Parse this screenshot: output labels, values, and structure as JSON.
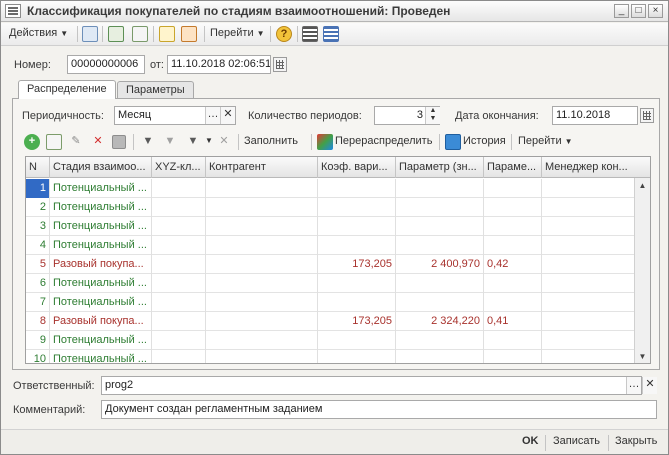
{
  "window": {
    "title": "Классификация покупателей по стадиям взаимоотношений: Проведен",
    "minimize": "_",
    "maximize": "□",
    "close": "×"
  },
  "toolbar": {
    "actions_label": "Действия",
    "goto_label": "Перейти",
    "icons": [
      "post-icon",
      "refresh-icon",
      "copy-icon",
      "export-icon",
      "import-icon",
      "help-icon",
      "structure-icon",
      "list-settings-icon"
    ]
  },
  "header": {
    "number_label": "Номер:",
    "number_value": "00000000006",
    "from_label": "от:",
    "date_value": "11.10.2018 02:06:51"
  },
  "tabs": [
    {
      "label": "Распределение",
      "active": true
    },
    {
      "label": "Параметры",
      "active": false
    }
  ],
  "params": {
    "periodicity_label": "Периодичность:",
    "periodicity_value": "Месяц",
    "period_count_label": "Количество периодов:",
    "period_count_value": "3",
    "end_date_label": "Дата окончания:",
    "end_date_value": "11.10.2018"
  },
  "table_toolbar": {
    "fill_label": "Заполнить",
    "redistribute_label": "Перераспределить",
    "history_label": "История",
    "goto_label": "Перейти"
  },
  "grid": {
    "columns": [
      "N",
      "Стадия взаимоо...",
      "XYZ-кл...",
      "Контрагент",
      "Коэф. вари...",
      "Параметр (зн...",
      "Параме...",
      "Менеджер кон..."
    ],
    "rows": [
      {
        "n": "1",
        "stage": "Потенциальный ...",
        "xyz": "",
        "contractor": "",
        "coef": "",
        "param": "",
        "param2": "",
        "manager": "",
        "kind": "green",
        "selected": true
      },
      {
        "n": "2",
        "stage": "Потенциальный ...",
        "xyz": "",
        "contractor": "",
        "coef": "",
        "param": "",
        "param2": "",
        "manager": "",
        "kind": "green",
        "selected": false
      },
      {
        "n": "3",
        "stage": "Потенциальный ...",
        "xyz": "",
        "contractor": "",
        "coef": "",
        "param": "",
        "param2": "",
        "manager": "",
        "kind": "green",
        "selected": false
      },
      {
        "n": "4",
        "stage": "Потенциальный ...",
        "xyz": "",
        "contractor": "",
        "coef": "",
        "param": "",
        "param2": "",
        "manager": "",
        "kind": "green",
        "selected": false
      },
      {
        "n": "5",
        "stage": "Разовый покупа...",
        "xyz": "",
        "contractor": "",
        "coef": "173,205",
        "param": "2 400,970",
        "param2": "0,42",
        "manager": "",
        "kind": "red",
        "selected": false
      },
      {
        "n": "6",
        "stage": "Потенциальный ...",
        "xyz": "",
        "contractor": "",
        "coef": "",
        "param": "",
        "param2": "",
        "manager": "",
        "kind": "green",
        "selected": false
      },
      {
        "n": "7",
        "stage": "Потенциальный ...",
        "xyz": "",
        "contractor": "",
        "coef": "",
        "param": "",
        "param2": "",
        "manager": "",
        "kind": "green",
        "selected": false
      },
      {
        "n": "8",
        "stage": "Разовый покупа...",
        "xyz": "",
        "contractor": "",
        "coef": "173,205",
        "param": "2 324,220",
        "param2": "0,41",
        "manager": "",
        "kind": "red",
        "selected": false
      },
      {
        "n": "9",
        "stage": "Потенциальный ...",
        "xyz": "",
        "contractor": "",
        "coef": "",
        "param": "",
        "param2": "",
        "manager": "",
        "kind": "green",
        "selected": false
      },
      {
        "n": "10",
        "stage": "Потенциальный ...",
        "xyz": "",
        "contractor": "",
        "coef": "",
        "param": "",
        "param2": "",
        "manager": "",
        "kind": "green",
        "selected": false
      }
    ]
  },
  "footer": {
    "responsible_label": "Ответственный:",
    "responsible_value": "prog2",
    "comment_label": "Комментарий:",
    "comment_value": "Документ создан регламентным заданием",
    "ok_label": "OK",
    "save_label": "Записать",
    "close_label": "Закрыть"
  },
  "colors": {
    "green_text": "#2e7d32",
    "red_text": "#a8322d",
    "selection": "#316ac5"
  }
}
